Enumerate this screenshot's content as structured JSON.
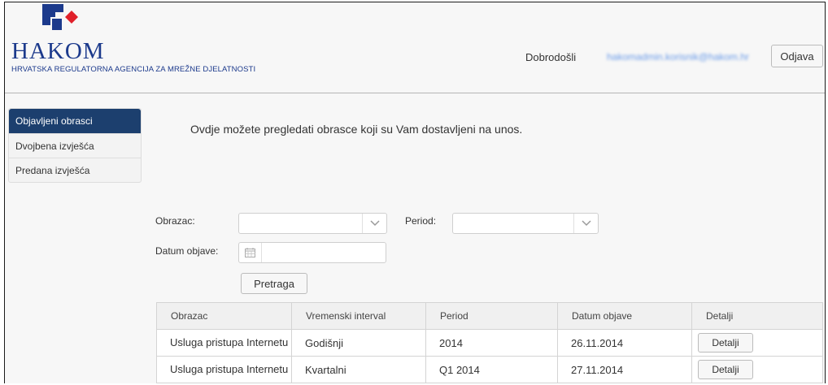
{
  "header": {
    "logo_text": "HAKOM",
    "logo_subtitle": "HRVATSKA REGULATORNA AGENCIJA ZA MREŽNE DJELATNOSTI",
    "welcome": "Dobrodošli",
    "user_email": "hakomadmin.korisnik@hakom.hr",
    "logout_label": "Odjava",
    "colors": {
      "brand_blue": "#1c3a8c",
      "brand_red": "#e0202a"
    }
  },
  "sidebar": {
    "items": [
      {
        "label": "Objavljeni obrasci",
        "active": true
      },
      {
        "label": "Dvojbena izvješća",
        "active": false
      },
      {
        "label": "Predana izvješća",
        "active": false
      }
    ],
    "active_color": "#1c3f6e"
  },
  "main": {
    "intro": "Ovdje možete pregledati obrasce koji su Vam dostavljeni na unos.",
    "filters": {
      "form_label": "Obrazac:",
      "form_value": "",
      "period_label": "Period:",
      "period_value": "",
      "date_label": "Datum objave:",
      "date_value": "",
      "calendar_icon": "calendar-icon",
      "chevron_icon": "chevron-down-icon"
    },
    "search_label": "Pretraga",
    "table": {
      "headers": [
        "Obrazac",
        "Vremenski interval",
        "Period",
        "Datum objave",
        "Detalji"
      ],
      "rows": [
        {
          "form": "Usluga pristupa Internetu",
          "interval": "Godišnji",
          "period": "2014",
          "date": "26.11.2014",
          "action": "Detalji"
        },
        {
          "form": "Usluga pristupa Internetu",
          "interval": "Kvartalni",
          "period": "Q1 2014",
          "date": "27.11.2014",
          "action": "Detalji"
        }
      ]
    }
  }
}
